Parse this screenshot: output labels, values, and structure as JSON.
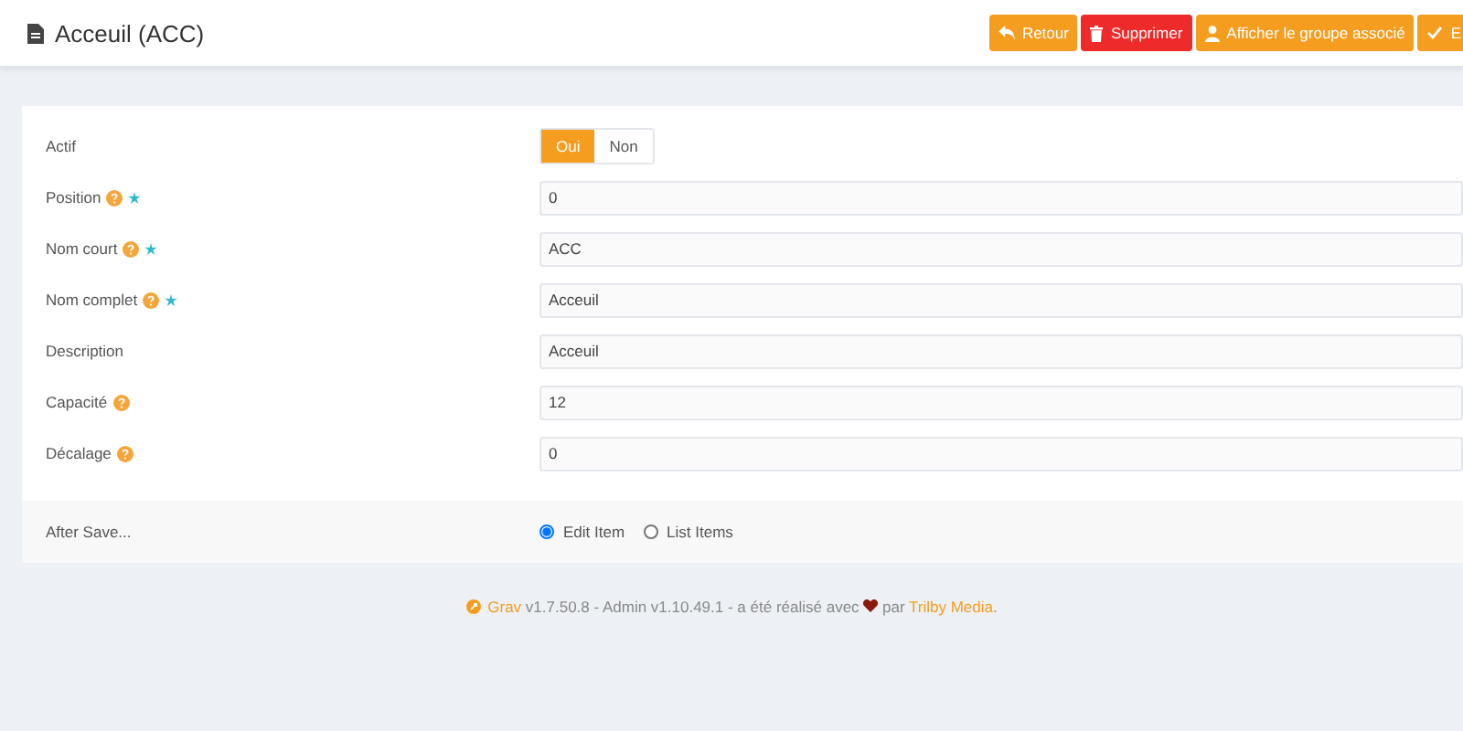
{
  "header": {
    "title": "Acceuil (ACC)",
    "buttons": [
      {
        "label": "Retour",
        "kind": "back"
      },
      {
        "label": "Supprimer",
        "kind": "delete"
      },
      {
        "label": "Afficher le groupe associé",
        "kind": "group"
      },
      {
        "label": "E",
        "kind": "save"
      }
    ]
  },
  "fields": [
    {
      "kind": "toggle",
      "label": "Actif",
      "help": false,
      "required": false,
      "options": [
        {
          "label": "Oui",
          "selected": true
        },
        {
          "label": "Non",
          "selected": false
        }
      ]
    },
    {
      "kind": "text",
      "label": "Position",
      "help": true,
      "required": true,
      "value": "0"
    },
    {
      "kind": "text",
      "label": "Nom court",
      "help": true,
      "required": true,
      "value": "ACC"
    },
    {
      "kind": "text",
      "label": "Nom complet",
      "help": true,
      "required": true,
      "value": "Acceuil"
    },
    {
      "kind": "text",
      "label": "Description",
      "help": false,
      "required": false,
      "value": "Acceuil"
    },
    {
      "kind": "text",
      "label": "Capacité",
      "help": true,
      "required": false,
      "value": "12"
    },
    {
      "kind": "text",
      "label": "Décalage",
      "help": true,
      "required": false,
      "value": "0"
    }
  ],
  "after_save": {
    "label": "After Save...",
    "options": [
      {
        "label": "Edit Item",
        "selected": true
      },
      {
        "label": "List Items",
        "selected": false
      }
    ]
  },
  "footer": {
    "grav_link": "Grav",
    "text": " v1.7.50.8 - Admin v1.10.49.1 - a été réalisé avec ",
    "by_text": " par ",
    "author_link": "Trilby Media",
    "end_text": "."
  }
}
